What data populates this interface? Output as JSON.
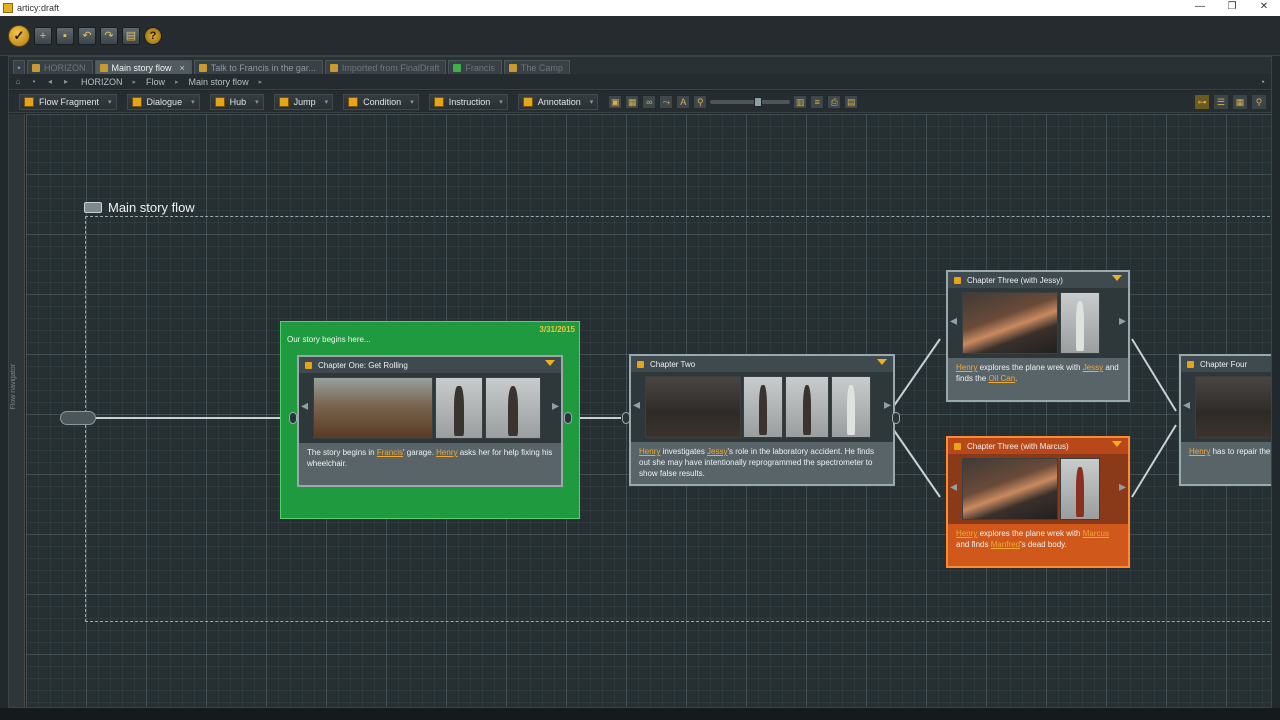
{
  "window": {
    "title": "articy:draft",
    "controls": [
      "—",
      "❐",
      "✕"
    ]
  },
  "quickbar": {
    "icons": [
      "app-logo",
      "new-icon",
      "save-icon",
      "undo-icon",
      "redo-icon",
      "export-icon",
      "help-icon"
    ]
  },
  "tabs": [
    {
      "label": "HORIZON",
      "state": "dim"
    },
    {
      "label": "Main story flow",
      "state": "active",
      "close": "×"
    },
    {
      "label": "Talk to Francis in the gar...",
      "state": "normal"
    },
    {
      "label": "Imported from FinalDraft",
      "state": "dim"
    },
    {
      "label": "Francis",
      "state": "dim"
    },
    {
      "label": "The Camp",
      "state": "dim"
    }
  ],
  "breadcrumb": {
    "items": [
      "HORIZON",
      "Flow",
      "Main story flow"
    ]
  },
  "object_toolbar": {
    "buttons": [
      "Flow Fragment",
      "Dialogue",
      "Hub",
      "Jump",
      "Condition",
      "Instruction",
      "Annotation"
    ]
  },
  "navigator": {
    "label": "Flow navigator"
  },
  "flow": {
    "title": "Main story flow",
    "intro_fragment": {
      "text": "Our story begins here...",
      "date": "3/31/2015"
    },
    "nodes": {
      "chapter_one": {
        "title": "Chapter One: Get Rolling",
        "text_parts": [
          "The story begins in ",
          "Francis",
          "' garage. ",
          "Henry",
          " asks her for help fixing his wheelchair."
        ]
      },
      "chapter_two": {
        "title": "Chapter Two",
        "text_parts": [
          "Henry",
          " investigates ",
          "Jessy",
          "'s role in the laboratory accident. He finds out she may have intentionally reprogrammed the spectrometer to show false results."
        ]
      },
      "chapter_three_jessy": {
        "title": "Chapter Three (with Jessy)",
        "text_parts": [
          "Henry",
          " explores the plane wrek with ",
          "Jessy",
          " and finds the ",
          "Oil Can",
          "."
        ]
      },
      "chapter_three_marcus": {
        "title": "Chapter Three (with Marcus)",
        "text_parts": [
          "Henry",
          " explores the plane wrek with ",
          "Marcus",
          " and finds ",
          "Manfred",
          "'s dead body."
        ]
      },
      "chapter_four": {
        "title": "Chapter Four",
        "text_parts": [
          "Henry",
          " has to repair the po"
        ]
      }
    }
  },
  "colors": {
    "accent": "#e8a418",
    "fragment_green": "#1f9a3e",
    "fragment_orange": "#d0581a",
    "link": "#f0a838"
  }
}
